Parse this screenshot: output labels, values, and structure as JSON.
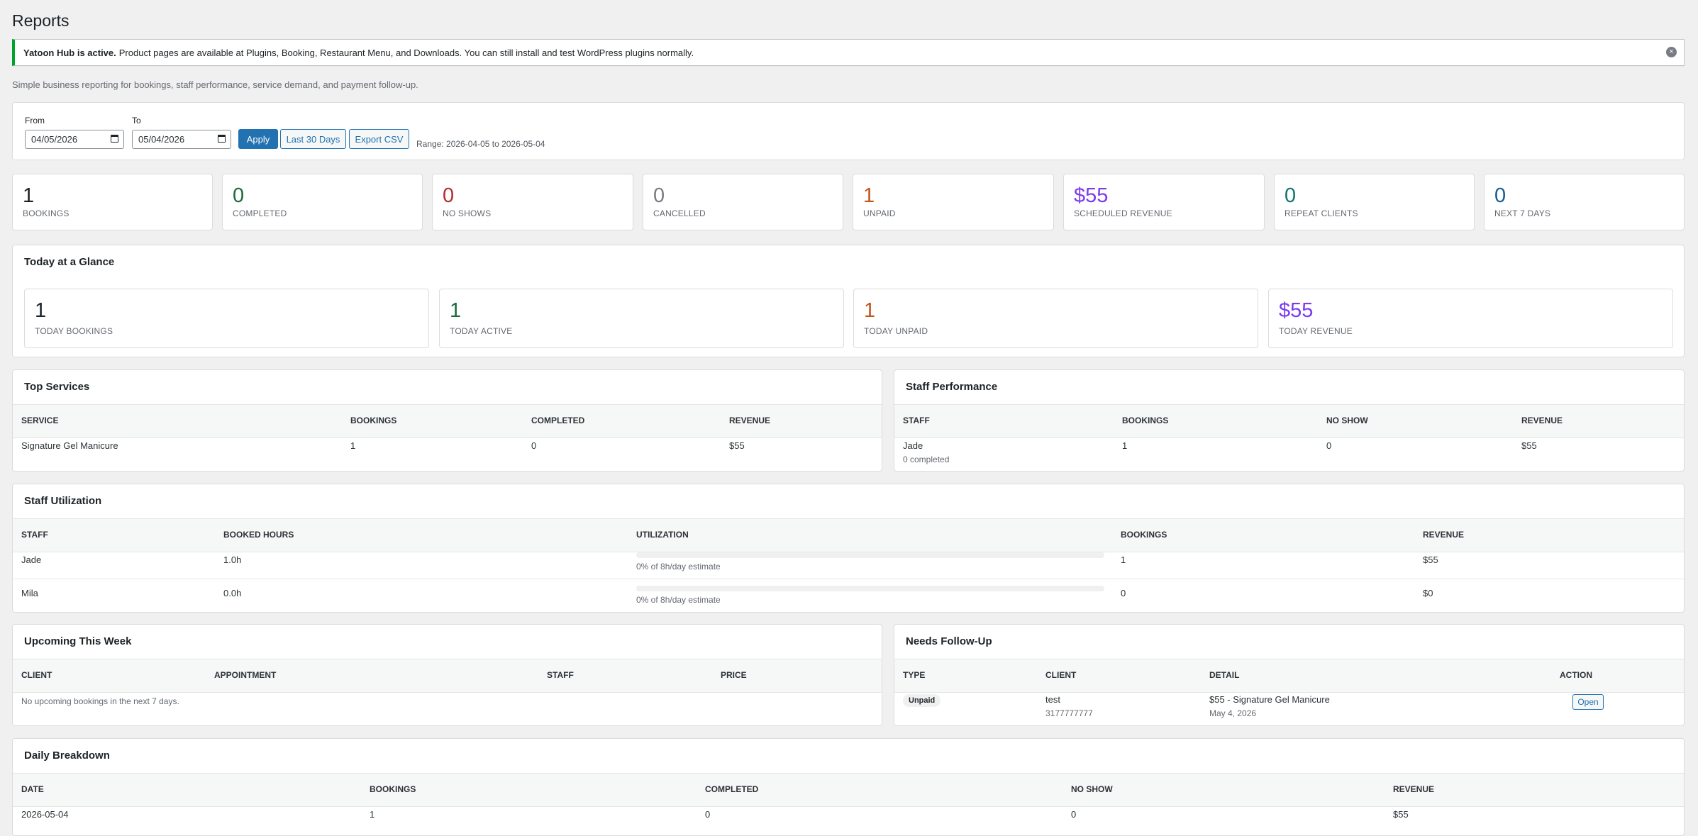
{
  "page": {
    "title": "Reports",
    "notice_bold": "Yatoon Hub is active.",
    "notice_text": "Product pages are available at Plugins, Booking, Restaurant Menu, and Downloads. You can still install and test WordPress plugins normally.",
    "dismiss_icon": "×",
    "subtitle": "Simple business reporting for bookings, staff performance, service demand, and payment follow-up."
  },
  "filters": {
    "from_label": "From",
    "from_value": "04/05/2026",
    "to_label": "To",
    "to_value": "05/04/2026",
    "apply": "Apply",
    "last30": "Last 30 Days",
    "export": "Export CSV",
    "range": "Range: 2026-04-05 to 2026-05-04"
  },
  "stats": [
    {
      "value": "1",
      "label": "Bookings",
      "color": "#1d2327"
    },
    {
      "value": "0",
      "label": "Completed",
      "color": "#1a6b3c"
    },
    {
      "value": "0",
      "label": "No Shows",
      "color": "#b32d2e"
    },
    {
      "value": "0",
      "label": "Cancelled",
      "color": "#787c82"
    },
    {
      "value": "1",
      "label": "Unpaid",
      "color": "#c2561a"
    },
    {
      "value": "$55",
      "label": "Scheduled Revenue",
      "color": "#7c3aed"
    },
    {
      "value": "0",
      "label": "Repeat Clients",
      "color": "#0f766e"
    },
    {
      "value": "0",
      "label": "Next 7 Days",
      "color": "#135e96"
    }
  ],
  "today": {
    "title": "Today at a Glance",
    "tiles": [
      {
        "value": "1",
        "label": "Today Bookings",
        "color": "#1d2327"
      },
      {
        "value": "1",
        "label": "Today Active",
        "color": "#1a6b3c"
      },
      {
        "value": "1",
        "label": "Today Unpaid",
        "color": "#c2561a"
      },
      {
        "value": "$55",
        "label": "Today Revenue",
        "color": "#7c3aed"
      }
    ]
  },
  "top_services": {
    "title": "Top Services",
    "headers": [
      "Service",
      "Bookings",
      "Completed",
      "Revenue"
    ],
    "rows": [
      {
        "service": "Signature Gel Manicure",
        "bookings": "1",
        "completed": "0",
        "revenue": "$55"
      }
    ]
  },
  "staff_performance": {
    "title": "Staff Performance",
    "headers": [
      "Staff",
      "Bookings",
      "No Show",
      "Revenue"
    ],
    "rows": [
      {
        "staff": "Jade",
        "sub": "0 completed",
        "bookings": "1",
        "no_show": "0",
        "revenue": "$55"
      }
    ]
  },
  "utilization": {
    "title": "Staff Utilization",
    "headers": [
      "Staff",
      "Booked Hours",
      "Utilization",
      "Bookings",
      "Revenue"
    ],
    "rows": [
      {
        "staff": "Jade",
        "hours": "1.0h",
        "util_text": "0% of 8h/day estimate",
        "util_fraction": 0,
        "bookings": "1",
        "revenue": "$55"
      },
      {
        "staff": "Mila",
        "hours": "0.0h",
        "util_text": "0% of 8h/day estimate",
        "util_fraction": 0,
        "bookings": "0",
        "revenue": "$0"
      }
    ]
  },
  "upcoming": {
    "title": "Upcoming This Week",
    "headers": [
      "Client",
      "Appointment",
      "Staff",
      "Price"
    ],
    "empty": "No upcoming bookings in the next 7 days."
  },
  "followup": {
    "title": "Needs Follow-Up",
    "headers": [
      "Type",
      "Client",
      "Detail",
      "Action"
    ],
    "rows": [
      {
        "type": "Unpaid",
        "client": "test",
        "phone": "3177777777",
        "detail": "$55 - Signature Gel Manicure",
        "date": "May 4, 2026",
        "action": "Open"
      }
    ]
  },
  "daily": {
    "title": "Daily Breakdown",
    "headers": [
      "Date",
      "Bookings",
      "Completed",
      "No Show",
      "Revenue"
    ],
    "rows": [
      {
        "date": "2026-05-04",
        "bookings": "1",
        "completed": "0",
        "no_show": "0",
        "revenue": "$55"
      }
    ]
  }
}
